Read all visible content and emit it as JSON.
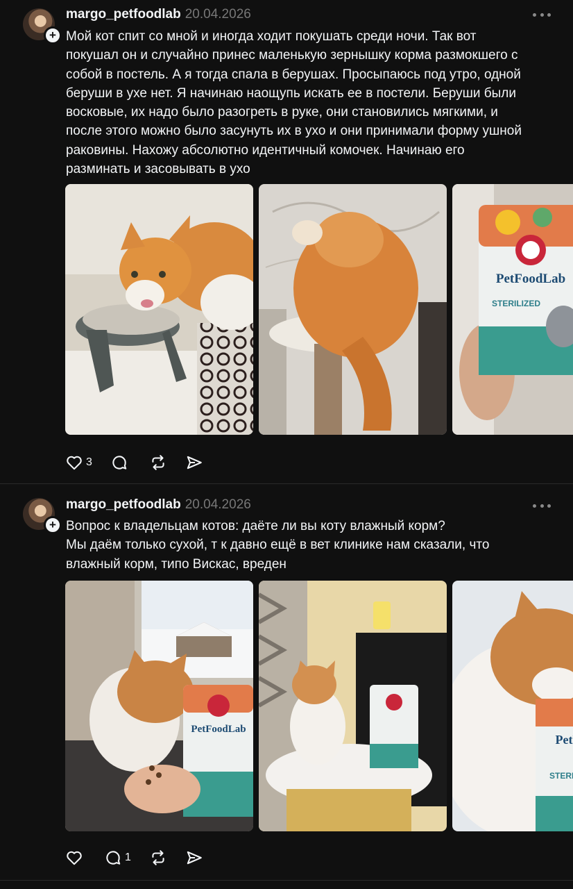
{
  "posts": [
    {
      "username": "margo_petfoodlab",
      "date": "20.04.2026",
      "text": "Мой кот спит со мной и иногда ходит покушать среди ночи. Так вот\nпокушал он и случайно принес маленькую зернышку корма размокшего с\nсобой в постель. А я тогда спала в берушах. Просыпаюсь под утро, одной\nберуши в ухе нет. Я начинаю наощупь искать ее в постели. Беруши были\nвосковые, их надо было разогреть в руке, они становились мягкими, и\nпосле этого можно было засунуть их в ухо и они принимали форму ушной\nраковины. Нахожу абсолютно идентичный комочек. Начинаю его\nразминать и засовывать в ухо",
      "likes": "3",
      "replies": "",
      "images": [
        "cat-eating-photo",
        "cat-on-scratching-post-photo",
        "petfoodlab-bag-photo"
      ],
      "bag_brand": "PetFoodLab",
      "bag_label": "STERILIZED"
    },
    {
      "username": "margo_petfoodlab",
      "date": "20.04.2026",
      "text": "Вопрос к владельцам котов: даёте ли вы коту влажный корм?\nМы даём только сухой, т к давно ещё в вет клинике нам сказали, что\nвлажный корм, типо Вискас, вреден",
      "likes": "",
      "replies": "1",
      "images": [
        "cat-window-hand-feeding-photo",
        "cat-on-table-photo",
        "cat-closeup-photo"
      ],
      "bag_brand": "PetFoodLab",
      "bag_label": "STERILIZED"
    }
  ],
  "icons": [
    "heart-icon",
    "comment-icon",
    "repost-icon",
    "share-icon",
    "more-icon",
    "follow-plus-icon"
  ]
}
